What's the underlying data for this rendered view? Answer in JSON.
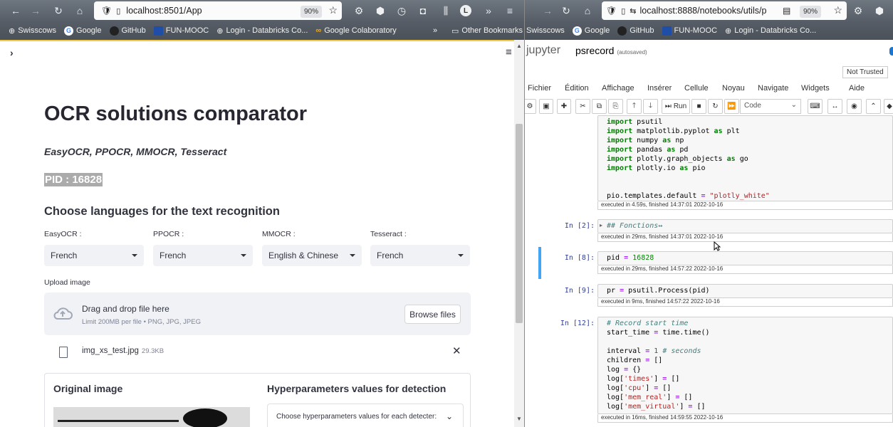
{
  "left_browser": {
    "url": "localhost:8501/App",
    "zoom": "90%",
    "profile_letter": "L",
    "bookmarks": [
      "Swisscows",
      "Google",
      "GitHub",
      "FUN-MOOC",
      "Login - Databricks Co...",
      "Google Colaboratory"
    ],
    "other_bookmarks": "Other Bookmarks"
  },
  "app": {
    "title": "OCR solutions comparator",
    "subtitle": "EasyOCR, PPOCR, MMOCR, Tesseract",
    "pid": "PID : 16828",
    "languages_heading": "Choose languages for the text recognition",
    "selectors": [
      {
        "label": "EasyOCR :",
        "value": "French"
      },
      {
        "label": "PPOCR :",
        "value": "French"
      },
      {
        "label": "MMOCR :",
        "value": "English & Chinese"
      },
      {
        "label": "Tesseract :",
        "value": "French"
      }
    ],
    "upload_label": "Upload image",
    "drop_title": "Drag and drop file here",
    "drop_limit": "Limit 200MB per file • PNG, JPG, JPEG",
    "browse": "Browse files",
    "file_name": "img_xs_test.jpg",
    "file_size": "29.3KB",
    "original_image": "Original image",
    "hyper_heading": "Hyperparameters values for detection",
    "hyper_expander": "Choose hyperparameters values for each detecter:"
  },
  "right_browser": {
    "url": "localhost:8888/notebooks/utils/p",
    "zoom": "90%",
    "bookmarks": [
      "Swisscows",
      "Google",
      "GitHub",
      "FUN-MOOC",
      "Login - Databricks Co..."
    ]
  },
  "jupyter": {
    "logo": "jupyter",
    "notebook_name": "psrecord",
    "autosave": "(autosaved)",
    "trust": "Not Trusted",
    "menu": [
      "Fichier",
      "Édition",
      "Affichage",
      "Insérer",
      "Cellule",
      "Noyau",
      "Navigate",
      "Widgets",
      "Aide"
    ],
    "run": "Run",
    "cell_type": "Code",
    "cells": [
      {
        "prompt": "",
        "exec": "executed in 4.59s, finished 14:37:01 2022-10-16"
      },
      {
        "prompt": "In [2]:",
        "code": "## Fonctions↔",
        "exec": "executed in 29ms, finished 14:37:01 2022-10-16"
      },
      {
        "prompt": "In [8]:",
        "code_a": "pid",
        "code_b": "16828",
        "exec": "executed in 29ms, finished 14:57:22 2022-10-16"
      },
      {
        "prompt": "In [9]:",
        "code_a": "pr",
        "code_b": "psutil.Process(pid)",
        "exec": "executed in 9ms, finished 14:57:22 2022-10-16"
      },
      {
        "prompt": "In [12]:",
        "comment": "# Record start time",
        "exec": "executed in 16ms, finished 14:59:55 2022-10-16"
      }
    ],
    "lines": {
      "l1": "psutil",
      "l2": "matplotlib.pyplot",
      "l2b": "plt",
      "l3": "numpy",
      "l3b": "np",
      "l4": "pandas",
      "l4b": "pd",
      "l5": "plotly.graph_objects",
      "l5b": "go",
      "l6": "plotly.io",
      "l6b": "pio",
      "l7": "pio.templates.default",
      "l7b": "\"plotly_white\"",
      "c1": "start_time",
      "c1b": "time.time()",
      "c2": "interval",
      "c2b": "1",
      "c2c": "# seconds",
      "c3": "children",
      "c3b": "[]",
      "c4": "log",
      "c4b": "{}",
      "c5k": "'times'",
      "c6k": "'cpu'",
      "c7k": "'mem_real'",
      "c8k": "'mem_virtual'"
    }
  }
}
